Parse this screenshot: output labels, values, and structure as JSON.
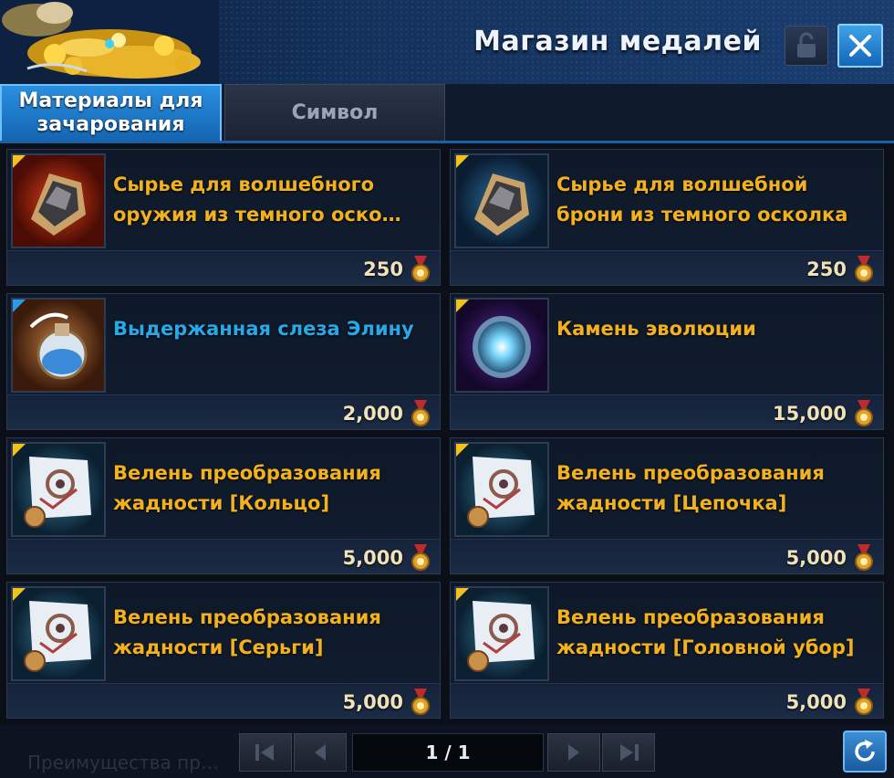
{
  "window": {
    "title": "Магазин медалей",
    "lock_icon": "lock-icon",
    "close_icon": "close-icon"
  },
  "tabs": [
    {
      "label": "Материалы для зачарования",
      "active": true
    },
    {
      "label": "Символ",
      "active": false
    }
  ],
  "items": [
    {
      "name": "Сырье для волшебного оружия из темного оско…",
      "price": "250",
      "icon": "dark-shard-weapon-icon",
      "name_color": "#f2b11d"
    },
    {
      "name": "Сырье для волшебной брони из темного осколка",
      "price": "250",
      "icon": "dark-shard-armor-icon",
      "name_color": "#f2b11d"
    },
    {
      "name": "Выдержанная слеза Элину",
      "price": "2,000",
      "icon": "elyn-tear-potion-icon",
      "name_color": "#29a8e8"
    },
    {
      "name": "Камень эволюции",
      "price": "15,000",
      "icon": "evolution-stone-icon",
      "name_color": "#f2b11d"
    },
    {
      "name": "Велень преобразования жадности [Кольцо]",
      "price": "5,000",
      "icon": "vellum-scroll-icon",
      "name_color": "#f2b11d"
    },
    {
      "name": "Велень преобразования жадности [Цепочка]",
      "price": "5,000",
      "icon": "vellum-scroll-icon",
      "name_color": "#f2b11d"
    },
    {
      "name": "Велень преобразования жадности [Серьги]",
      "price": "5,000",
      "icon": "vellum-scroll-icon",
      "name_color": "#f2b11d"
    },
    {
      "name": "Велень преобразования жадности [Головной убор]",
      "price": "5,000",
      "icon": "vellum-scroll-icon",
      "name_color": "#f2b11d"
    }
  ],
  "pagination": {
    "page": "1 / 1"
  },
  "footer": {
    "hint": "Преимущества пр…"
  },
  "colors": {
    "accent": "#1d6fc0",
    "item_name": "#f2b11d",
    "item_name_rare": "#29a8e8",
    "price": "#f0e2b8"
  }
}
